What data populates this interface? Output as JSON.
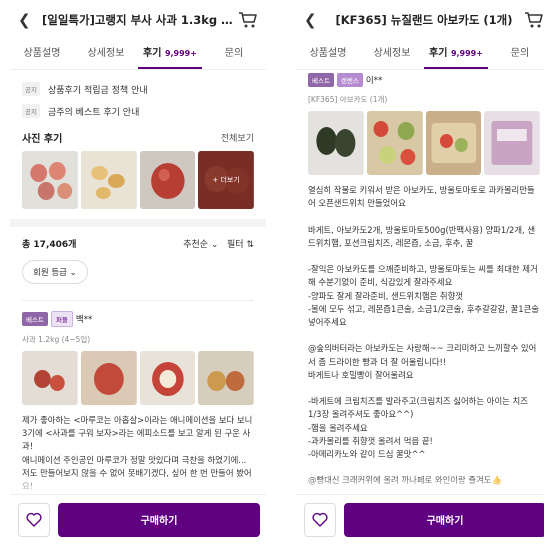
{
  "left": {
    "header": {
      "back_icon": "chevron-left-icon",
      "title": "[일일특가]고랭지 부사 사과 1.3kg (...",
      "cart_icon": "cart-icon"
    },
    "tabs": [
      {
        "label": "상품설명",
        "count": ""
      },
      {
        "label": "상세정보",
        "count": ""
      },
      {
        "label": "후기",
        "count": "9,999+"
      },
      {
        "label": "문의",
        "count": ""
      }
    ],
    "notices": [
      {
        "tag": "공지",
        "text": "상품후기 적립금 정책 안내"
      },
      {
        "tag": "공지",
        "text": "금주의 베스트 후기 안내"
      }
    ],
    "photo_section": {
      "title": "사진 후기",
      "more": "전체보기",
      "overlay": "+ 더보기"
    },
    "stats": {
      "total": "총 17,406개",
      "sort": "추천순 ⌄",
      "filter": "필터 ⇅"
    },
    "filter_chip": "회원 등급 ⌄",
    "review": {
      "badge1": "베스트",
      "badge2": "퍼플",
      "user": "백**",
      "option": "사과 1.2kg (4~5입)",
      "body": "제가 좋아하는 <마루코는 아홉살>이라는 애니메이션을 보다 보니 3기에 <사과를 구워 보자>라는 에피소드를 보고 알게 된 구운 사과!\n애니메이션 주인공인 마루코가 정말 맛있다며 극찬을 하였기에... 저도 만들어보지 않을 수 없어 못배기겠다, 싶어 한 번 만들어 봤어요!\n\n사과를 구워야 하니 작은 크기의 사과를 찾게 되었는데요\n마켓컬리에 딱 좋은 한입 크기의 미니 사과를 판매하여"
    },
    "buy_label": "구매하기",
    "heart_icon": "heart-icon"
  },
  "right": {
    "header": {
      "back_icon": "chevron-left-icon",
      "title": "[KF365] 뉴질랜드 아보카도 (1개)",
      "cart_icon": "cart-icon"
    },
    "tabs": [
      {
        "label": "상품설명",
        "count": ""
      },
      {
        "label": "상세정보",
        "count": ""
      },
      {
        "label": "후기",
        "count": "9,999+"
      },
      {
        "label": "문의",
        "count": ""
      }
    ],
    "review": {
      "badge1": "베스트",
      "badge2": "랜벤스",
      "user": "이**",
      "option": "[KF365] 아보카도 (1개)",
      "body": "열심히 작물로 키워서 받은 아보카도, 방울토마토로 과카몰리만들어 오픈샌드위치 만들었어요\n\n바게트, 아보카도2개, 방울토마토500g(반팩사용) 양파1/2개, 샌드위치햄, 포션크림치즈, 레몬즙, 소금, 후추, 꿀\n\n-잘익은 아보카도를 으깨준비하고, 방울토마토는 씨를 최대한 제거해 수분기없이 준비, 식감있게 잘라주세요\n-양파도 잘게 잘라준비, 샌드위치햄은 취향껏\n-볼에 모두 섞고, 레몬즙1큰술, 소금1/2큰술, 후추갈갈갈, 꿀1큰술 넣어주세요\n\n@숲의버터라는 아보카도는 사랑해~~ 크리미하고 느끼할수 있어서 좀 드라이한 빵과 더 잘 어울립니다!!\n바게트나 호밀빵이 잘어울려요\n\n-바게트에 크림치즈를 발라주고(크림치즈 싫어하는 아이는 치즈1/3장 올려주셔도 좋아요^^)\n-햄을 올려주세요\n-과카몰리를 취향껏 올려서 먹음 끝!\n-아메리카노와 같이 드심 꿀맛^^\n\n@빵대신 크래커위에 올려 까나페로 와인이랑 즐겨도👍"
    },
    "buy_label": "구매하기",
    "heart_icon": "heart-icon"
  }
}
